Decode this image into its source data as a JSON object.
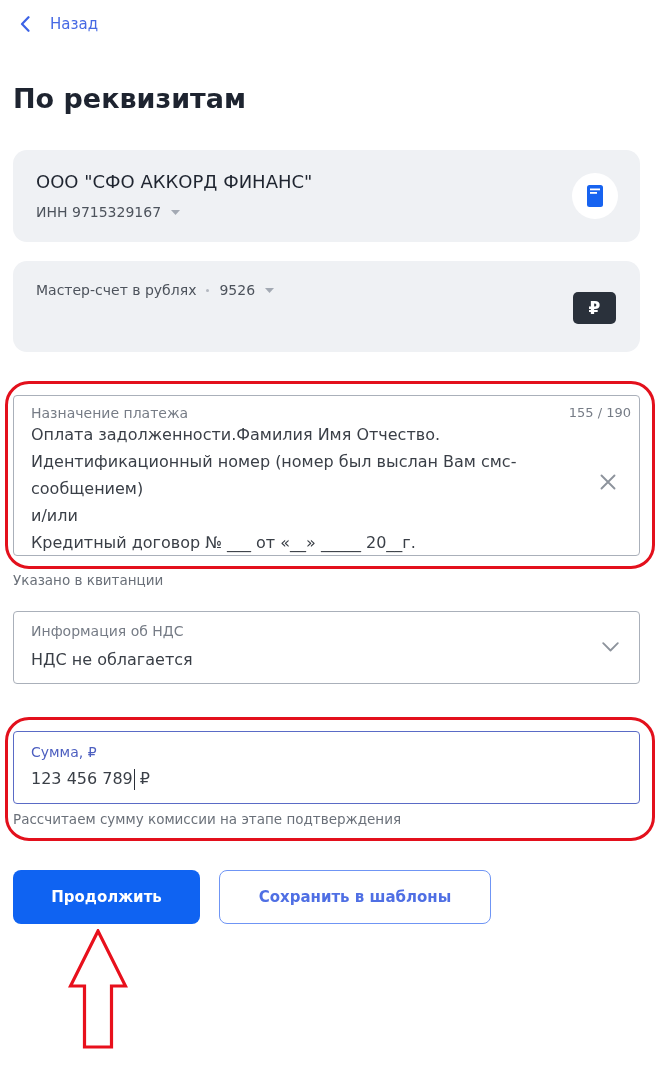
{
  "back_link": {
    "label": "Назад"
  },
  "title": "По реквизитам",
  "recipient": {
    "name": "ООО \"СФО АККОРД ФИНАНС\"",
    "inn": "ИНН 9715329167"
  },
  "account": {
    "name": "Мастер-счет в рублях",
    "number": "9526",
    "currency_symbol": "₽"
  },
  "fields": [
    {
      "kind": "textarea",
      "label": "Назначение платежа",
      "counter": "155 / 190",
      "value": "Оплата задолженности.Фамилия Имя Отчество.\nИдентификационный номер (номер был выслан Вам смс-\nсообщением)\nи/или\nКредитный договор № ___ от «__» _____ 20__г.",
      "hint": "Указано в квитанции",
      "focused": false,
      "highlighted": true,
      "hint_highlighted": false
    },
    {
      "kind": "select",
      "label": "Информация об НДС",
      "value": "НДС не облагается",
      "focused": false,
      "highlighted": false
    },
    {
      "kind": "amount",
      "label": "Сумма, ₽",
      "value": "123 456 789",
      "currency": "₽",
      "hint": "Рассчитаем сумму комиссии на этапе подтверждения",
      "focused": true,
      "highlighted": true,
      "hint_highlighted": true
    }
  ],
  "buttons": [
    {
      "kind": "primary",
      "label": "Продолжить",
      "annotated": true
    },
    {
      "kind": "secondary",
      "label": "Сохранить в шаблоны",
      "annotated": false
    }
  ]
}
